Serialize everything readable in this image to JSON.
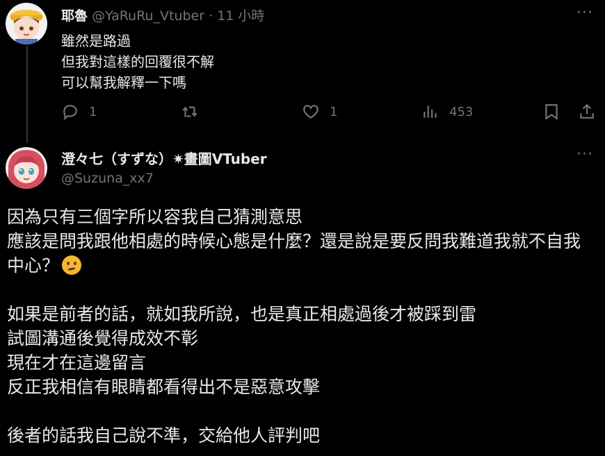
{
  "reply": {
    "name": "耶魯",
    "handle": "@YaRuRu_Vtuber",
    "separator": "·",
    "time": "11 小時",
    "more": "···",
    "lines": [
      "雖然是路過",
      "但我對這樣的回覆很不解",
      "可以幫我解釋一下嗎"
    ],
    "actions": {
      "reply_count": "1",
      "retweet_count": "",
      "like_count": "1",
      "view_count": "453"
    }
  },
  "main": {
    "name": "澄々七（すずな）✷畫圖VTuber",
    "handle": "@Suzuna_xx7",
    "more": "···",
    "lines": [
      "因為只有三個字所以容我自己猜測意思",
      "應該是問我跟他相處的時候心態是什麼？還是說是要反問我難道我就不自我",
      "中心？",
      "",
      "如果是前者的話，就如我所說，也是真正相處過後才被踩到雷",
      "試圖溝通後覺得成效不彰",
      "現在才在這邊留言",
      "反正我相信有眼睛都看得出不是惡意攻擊",
      "",
      "後者的話我自己說不準，交給他人評判吧"
    ]
  },
  "colors": {
    "background": "#000000",
    "text": "#e7e9ea",
    "muted": "#71767b",
    "thread_line": "#333639"
  },
  "icons": [
    "reply-icon",
    "retweet-icon",
    "like-icon",
    "views-icon",
    "bookmark-icon",
    "share-icon",
    "thinking-face-emoji"
  ]
}
